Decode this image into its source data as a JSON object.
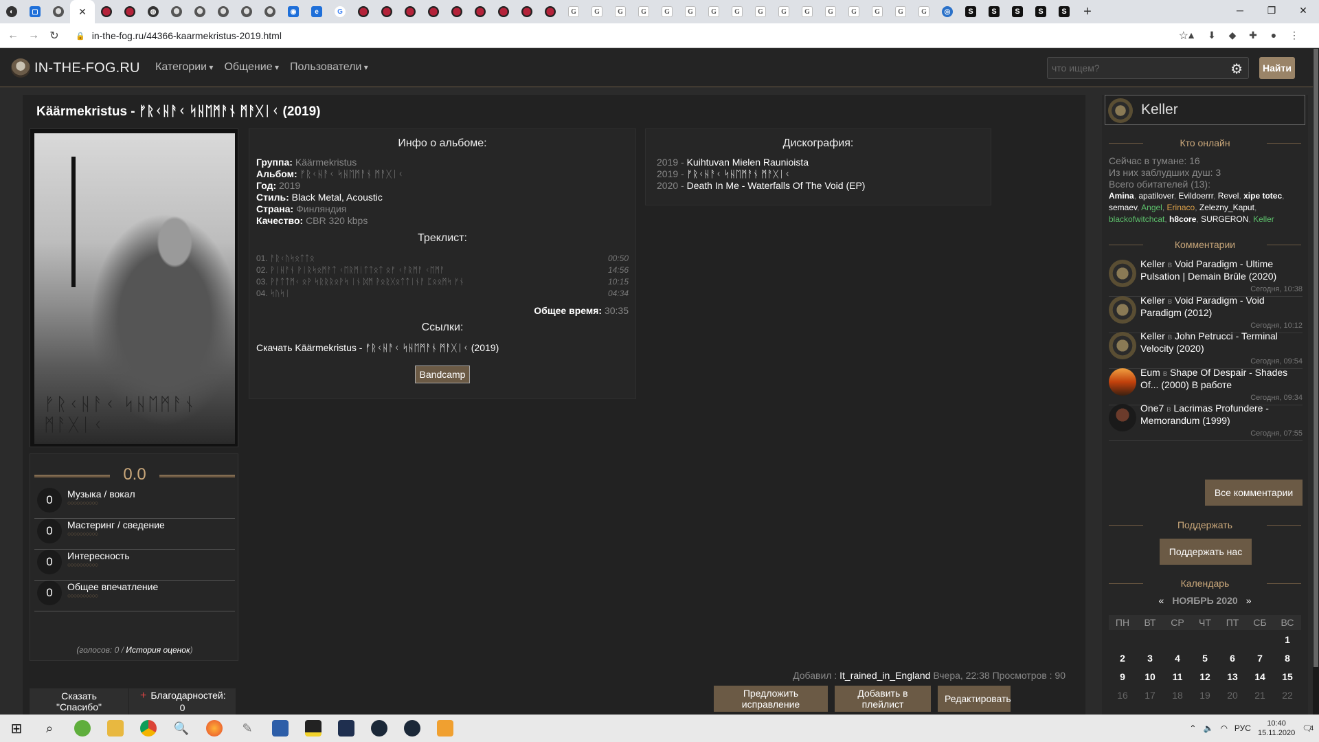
{
  "browser": {
    "url": "in-the-fog.ru/44366-kaarmekristus-2019.html",
    "tabs": [
      {
        "icon": "chrome-icon",
        "cls": "mx",
        "glyph": "◐"
      },
      {
        "icon": "blue-app-icon",
        "cls": "blue",
        "glyph": "▢"
      },
      {
        "icon": "owl-icon",
        "cls": "owl",
        "glyph": ""
      },
      {
        "icon": "close-icon",
        "cls": "active",
        "glyph": ""
      },
      {
        "icon": "red-band-icon",
        "cls": "red",
        "glyph": ""
      },
      {
        "icon": "red-band-icon",
        "cls": "red",
        "glyph": ""
      },
      {
        "icon": "mixcloud-icon",
        "cls": "mx",
        "glyph": "◍"
      },
      {
        "icon": "owl-icon",
        "cls": "owl",
        "glyph": ""
      },
      {
        "icon": "owl-icon",
        "cls": "owl",
        "glyph": ""
      },
      {
        "icon": "owl-icon",
        "cls": "owl",
        "glyph": ""
      },
      {
        "icon": "owl-icon",
        "cls": "owl",
        "glyph": ""
      },
      {
        "icon": "owl-icon",
        "cls": "owl",
        "glyph": ""
      },
      {
        "icon": "orange-app-icon",
        "cls": "blue",
        "glyph": "◉"
      },
      {
        "icon": "edge-icon",
        "cls": "blue",
        "glyph": "e"
      },
      {
        "icon": "google-icon",
        "cls": "goo",
        "glyph": "G"
      },
      {
        "icon": "red-band-icon",
        "cls": "red",
        "glyph": ""
      },
      {
        "icon": "red-band-icon",
        "cls": "red",
        "glyph": ""
      },
      {
        "icon": "red-band-icon",
        "cls": "red",
        "glyph": ""
      },
      {
        "icon": "red-band-icon",
        "cls": "red",
        "glyph": ""
      },
      {
        "icon": "red-band-icon",
        "cls": "red",
        "glyph": ""
      },
      {
        "icon": "red-band-icon",
        "cls": "red",
        "glyph": ""
      },
      {
        "icon": "red-band-icon",
        "cls": "red",
        "glyph": ""
      },
      {
        "icon": "red-band-icon",
        "cls": "red",
        "glyph": ""
      },
      {
        "icon": "red-band-icon",
        "cls": "red",
        "glyph": ""
      },
      {
        "icon": "g-icon",
        "cls": "g",
        "glyph": "G"
      },
      {
        "icon": "g-icon",
        "cls": "g",
        "glyph": "G"
      },
      {
        "icon": "g-icon",
        "cls": "g",
        "glyph": "G"
      },
      {
        "icon": "g-icon",
        "cls": "g",
        "glyph": "G"
      },
      {
        "icon": "g-icon",
        "cls": "g",
        "glyph": "G"
      },
      {
        "icon": "g-icon",
        "cls": "g",
        "glyph": "G"
      },
      {
        "icon": "g-icon",
        "cls": "g",
        "glyph": "G"
      },
      {
        "icon": "g-icon",
        "cls": "g",
        "glyph": "G"
      },
      {
        "icon": "g-icon",
        "cls": "g",
        "glyph": "G"
      },
      {
        "icon": "g-icon",
        "cls": "g",
        "glyph": "G"
      },
      {
        "icon": "g-icon",
        "cls": "g",
        "glyph": "G"
      },
      {
        "icon": "g-icon",
        "cls": "g",
        "glyph": "G"
      },
      {
        "icon": "g-icon",
        "cls": "g",
        "glyph": "G"
      },
      {
        "icon": "g-icon",
        "cls": "g",
        "glyph": "G"
      },
      {
        "icon": "g-icon",
        "cls": "g",
        "glyph": "G"
      },
      {
        "icon": "g-icon",
        "cls": "g",
        "glyph": "G"
      },
      {
        "icon": "globe-icon",
        "cls": "glob",
        "glyph": "◎"
      },
      {
        "icon": "s-icon",
        "cls": "s",
        "glyph": "S"
      },
      {
        "icon": "s-icon",
        "cls": "s",
        "glyph": "S"
      },
      {
        "icon": "s-icon",
        "cls": "s",
        "glyph": "S"
      },
      {
        "icon": "s-icon",
        "cls": "s",
        "glyph": "S"
      },
      {
        "icon": "s-icon",
        "cls": "s",
        "glyph": "S"
      }
    ]
  },
  "site": {
    "logo": "IN-THE-FOG.RU",
    "menu": [
      "Категории",
      "Общение",
      "Пользователи"
    ],
    "search_placeholder": "что ищем?",
    "search_button": "Найти"
  },
  "album": {
    "title": "Käärmekristus - ᚠᚱᚲᚺᚨᚲ ᛋᚺᛖᛗᚨᚾ ᛗᚨᚷᛁᚲ (2019)",
    "cover_caption": "ᚠᚱᚲᚺᚨᚲ ᛋᚺᛖᛗᚨᚾ ᛗᚨᚷᛁᚲ",
    "info_heading": "Инфо о альбоме:",
    "fields": [
      {
        "label": "Группа:",
        "value": "Käärmekristus",
        "style": "v"
      },
      {
        "label": "Альбом:",
        "value": "ᚠᚱᚲᚺᚨᚲ ᛋᚺᛖᛗᚨᚾ ᛗᚨᚷᛁᚲ",
        "style": "v"
      },
      {
        "label": "Год:",
        "value": "2019",
        "style": "v"
      },
      {
        "label": "Стиль:",
        "value": "Black Metal, Acoustic",
        "style": "w"
      },
      {
        "label": "Страна:",
        "value": "Финляндия",
        "style": "v"
      },
      {
        "label": "Качество:",
        "value": "CBR 320 kbps",
        "style": "v"
      }
    ],
    "tracklist_heading": "Треклист:",
    "tracks": [
      {
        "title": "01. ᚨᚱᚲᚢᛋᛟᛏᛏᛟ",
        "time": "00:50"
      },
      {
        "title": "02. ᚹᛁᚺᚨᚾ ᚹᛁᚱᛋᛟᛗᚨᛏ ᚲᛖᚱᛗᛁᛏᛏᛟᛏ ᛟᚠ ᚲᚨᚱᛗᚨ ᚲᛖᛗᚨ",
        "time": "14:56"
      },
      {
        "title": "03. ᚹᚨᛏᛏᛗᚲ ᛟᚹ ᛋᚱᚱᚱᛟᚹᛋ ᛁᚾ ᛞᛗ ᚹᛟᚱᚷᛟᛏᛏᛁᚾᚨ ᛈᛟᛟᛗᛋ ᚠᚾ",
        "time": "10:15"
      },
      {
        "title": "04. ᛋᚢᛋᛁ",
        "time": "04:34"
      }
    ],
    "total_label": "Общее время:",
    "total_time": "30:35",
    "links_heading": "Ссылки:",
    "download_text": "Скачать Käärmekristus - ᚠᚱᚲᚺᚨᚲ ᛋᚺᛖᛗᚨᚾ ᛗᚨᚷᛁᚲ (2019)",
    "bandcamp": "Bandcamp"
  },
  "discography": {
    "heading": "Дискография:",
    "items": [
      {
        "year": "2019 -",
        "title": "Kuihtuvan Mielen Raunioista"
      },
      {
        "year": "2019 -",
        "title": "ᚠᚱᚲᚺᚨᚲ ᛋᚺᛖᛗᚨᚾ ᛗᚨᚷᛁᚲ"
      },
      {
        "year": "2020 -",
        "title": "Death In Me - Waterfalls Of The Void (EP)"
      }
    ]
  },
  "ratings": {
    "score": "0.0",
    "rows": [
      {
        "label": "Музыка / вокал",
        "value": "0"
      },
      {
        "label": "Мастеринг / сведение",
        "value": "0"
      },
      {
        "label": "Интересность",
        "value": "0"
      },
      {
        "label": "Общее впечатление",
        "value": "0"
      }
    ],
    "dots": "○○○○○○○○○○",
    "votes_text": "(голосов: 0 /",
    "history_link": "История оценок",
    "votes_close": ")"
  },
  "meta": {
    "added_label": "Добавил :",
    "added_user": "It_rained_in_England",
    "added_time": "Вчера, 22:38",
    "views": "Просмотров : 90"
  },
  "actions": {
    "thanks": "Сказать \"Спасибо\"",
    "thanks_count": "Благодарностей: 0",
    "suggest": "Предложить исправление",
    "playlist": "Добавить в плейлист",
    "edit": "Редактировать"
  },
  "sidebar": {
    "username": "Keller",
    "online_heading": "Кто онлайн",
    "online_now": "Сейчас в тумане: 16",
    "lost_souls": "Из них заблудших душ: 3",
    "residents": "Всего обитателей (13):",
    "users": [
      {
        "name": "Amina",
        "cls": "u-b"
      },
      {
        "name": "apatilover",
        "cls": "u-w"
      },
      {
        "name": "Evildoerrr",
        "cls": "u-w"
      },
      {
        "name": "Revel",
        "cls": "u-w"
      },
      {
        "name": "xipe totec",
        "cls": "u-b"
      },
      {
        "name": "semaev",
        "cls": "u-w"
      },
      {
        "name": "Angel",
        "cls": "u-g"
      },
      {
        "name": "Erinaco",
        "cls": "u-o"
      },
      {
        "name": "Zelezny_Kaput",
        "cls": "u-w"
      },
      {
        "name": "blackofwitchcat",
        "cls": "u-g"
      },
      {
        "name": "h8core",
        "cls": "u-b"
      },
      {
        "name": "SURGERON",
        "cls": "u-w"
      },
      {
        "name": "Keller",
        "cls": "u-g"
      }
    ],
    "comments_heading": "Комментарии",
    "comments": [
      {
        "user": "Keller",
        "in": "в",
        "title": "Void Paradigm - Ultime Pulsation | Demain Brûle (2020)",
        "time": "Сегодня, 10:38",
        "av": "keller"
      },
      {
        "user": "Keller",
        "in": "в",
        "title": "Void Paradigm - Void Paradigm (2012)",
        "time": "Сегодня, 10:12",
        "av": "keller"
      },
      {
        "user": "Keller",
        "in": "в",
        "title": "John Petrucci - Terminal Velocity (2020)",
        "time": "Сегодня, 09:54",
        "av": "keller"
      },
      {
        "user": "Eum",
        "in": "в",
        "title": "Shape Of Despair - Shades Of... (2000) В работе",
        "time": "Сегодня, 09:34",
        "av": "eum"
      },
      {
        "user": "One7",
        "in": "в",
        "title": "Lacrimas Profundere - Memorandum (1999)",
        "time": "Сегодня, 07:55",
        "av": "one7"
      }
    ],
    "all_comments": "Все комментарии",
    "support_heading": "Поддержать",
    "support_button": "Поддержать нас",
    "calendar_heading": "Календарь",
    "calendar_prev": "«",
    "calendar_month": "НОЯБРЬ 2020",
    "calendar_next": "»",
    "weekdays": [
      "ПН",
      "ВТ",
      "СР",
      "ЧТ",
      "ПТ",
      "СБ",
      "ВС"
    ],
    "weeks": [
      [
        "",
        "",
        "",
        "",
        "",
        "",
        "1"
      ],
      [
        "2",
        "3",
        "4",
        "5",
        "6",
        "7",
        "8"
      ],
      [
        "9",
        "10",
        "11",
        "12",
        "13",
        "14",
        "15"
      ],
      [
        "16",
        "17",
        "18",
        "19",
        "20",
        "21",
        "22"
      ]
    ]
  },
  "taskbar": {
    "lang": "РУС",
    "time": "10:40",
    "date": "15.11.2020",
    "notifications": "4"
  }
}
